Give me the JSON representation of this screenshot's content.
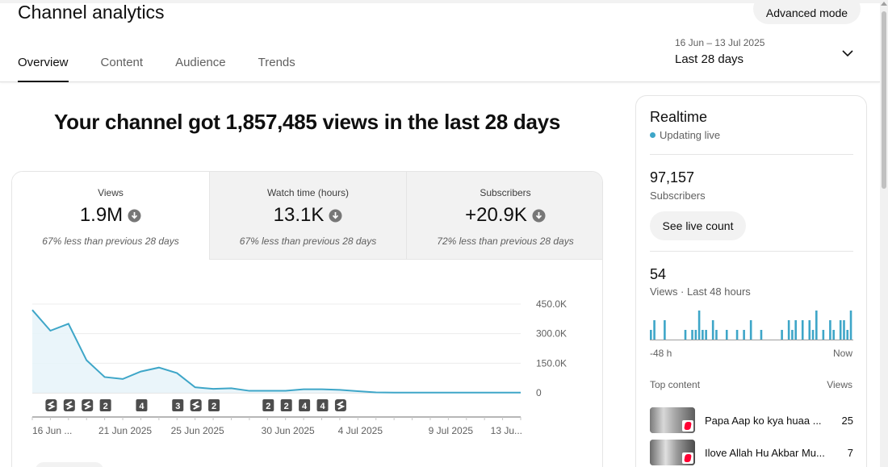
{
  "header": {
    "title": "Channel analytics",
    "advanced_mode": "Advanced mode",
    "tabs": [
      {
        "label": "Overview",
        "active": true
      },
      {
        "label": "Content",
        "active": false
      },
      {
        "label": "Audience",
        "active": false
      },
      {
        "label": "Trends",
        "active": false
      }
    ],
    "date_range": {
      "sub": "16 Jun – 13 Jul 2025",
      "main": "Last 28 days"
    }
  },
  "headline": "Your channel got 1,857,485 views in the last 28 days",
  "metrics": [
    {
      "label": "Views",
      "value": "1.9M",
      "note": "67% less than previous 28 days"
    },
    {
      "label": "Watch time (hours)",
      "value": "13.1K",
      "note": "67% less than previous 28 days"
    },
    {
      "label": "Subscribers",
      "value": "+20.9K",
      "note": "72% less than previous 28 days"
    }
  ],
  "colors": {
    "line": "#3ea6c8",
    "fill": "#e8f4fa",
    "accent": "#0f0f0f",
    "marker": "#4d4d4d"
  },
  "chart_data": {
    "type": "area",
    "x_labels": [
      "16 Jun ...",
      "21 Jun 2025",
      "25 Jun 2025",
      "30 Jun 2025",
      "4 Jul 2025",
      "9 Jul 2025",
      "13 Ju..."
    ],
    "x_label_days": [
      0,
      5,
      9,
      14,
      18,
      23,
      27
    ],
    "x": [
      0,
      1,
      2,
      3,
      4,
      5,
      6,
      7,
      8,
      9,
      10,
      11,
      12,
      13,
      14,
      15,
      16,
      17,
      18,
      19,
      20,
      21,
      22,
      23,
      24,
      25,
      26,
      27
    ],
    "y": [
      420000,
      315000,
      350000,
      165000,
      80000,
      70000,
      108000,
      128000,
      100000,
      28000,
      20000,
      23000,
      10000,
      10000,
      10000,
      18000,
      18000,
      15000,
      8000,
      2000,
      1000,
      1000,
      1000,
      1000,
      1000,
      1000,
      1000,
      1000
    ],
    "y_ticks": [
      "450.0K",
      "300.0K",
      "150.0K",
      "0"
    ],
    "y_tick_values": [
      450000,
      300000,
      150000,
      0
    ],
    "ylim": [
      0,
      450000
    ],
    "markers": [
      {
        "day": 1,
        "label": "shorts"
      },
      {
        "day": 2,
        "label": "shorts"
      },
      {
        "day": 3,
        "label": "shorts"
      },
      {
        "day": 4,
        "label": "2"
      },
      {
        "day": 6,
        "label": "4"
      },
      {
        "day": 8,
        "label": "3"
      },
      {
        "day": 9,
        "label": "shorts"
      },
      {
        "day": 10,
        "label": "2"
      },
      {
        "day": 13,
        "label": "2"
      },
      {
        "day": 14,
        "label": "2"
      },
      {
        "day": 15,
        "label": "4"
      },
      {
        "day": 16,
        "label": "4"
      },
      {
        "day": 17,
        "label": "shorts"
      }
    ]
  },
  "realtime": {
    "title": "Realtime",
    "live": "Updating live",
    "subscribers": "97,157",
    "subscribers_label": "Subscribers",
    "see_live": "See live count",
    "views": "54",
    "views_label": "Views · Last 48 hours",
    "hourly_views": [
      1,
      2,
      0,
      0,
      2,
      0,
      0,
      0,
      0,
      0,
      1,
      0,
      1,
      1,
      3,
      1,
      1,
      0,
      2,
      1,
      0,
      0,
      1,
      0,
      0,
      1,
      0,
      1,
      0,
      2,
      0,
      0,
      1,
      0,
      0,
      0,
      0,
      0,
      1,
      0,
      2,
      1,
      2,
      0,
      2,
      0,
      2,
      1,
      3,
      0,
      1,
      0,
      2,
      1,
      0,
      2,
      2,
      1,
      3
    ],
    "axis_left": "-48 h",
    "axis_right": "Now",
    "top_content_label": "Top content",
    "views_col": "Views",
    "items": [
      {
        "title": "Papa Aap ko kya huaa ...",
        "views": "25"
      },
      {
        "title": "Ilove Allah Hu Akbar Mu...",
        "views": "7"
      }
    ]
  }
}
